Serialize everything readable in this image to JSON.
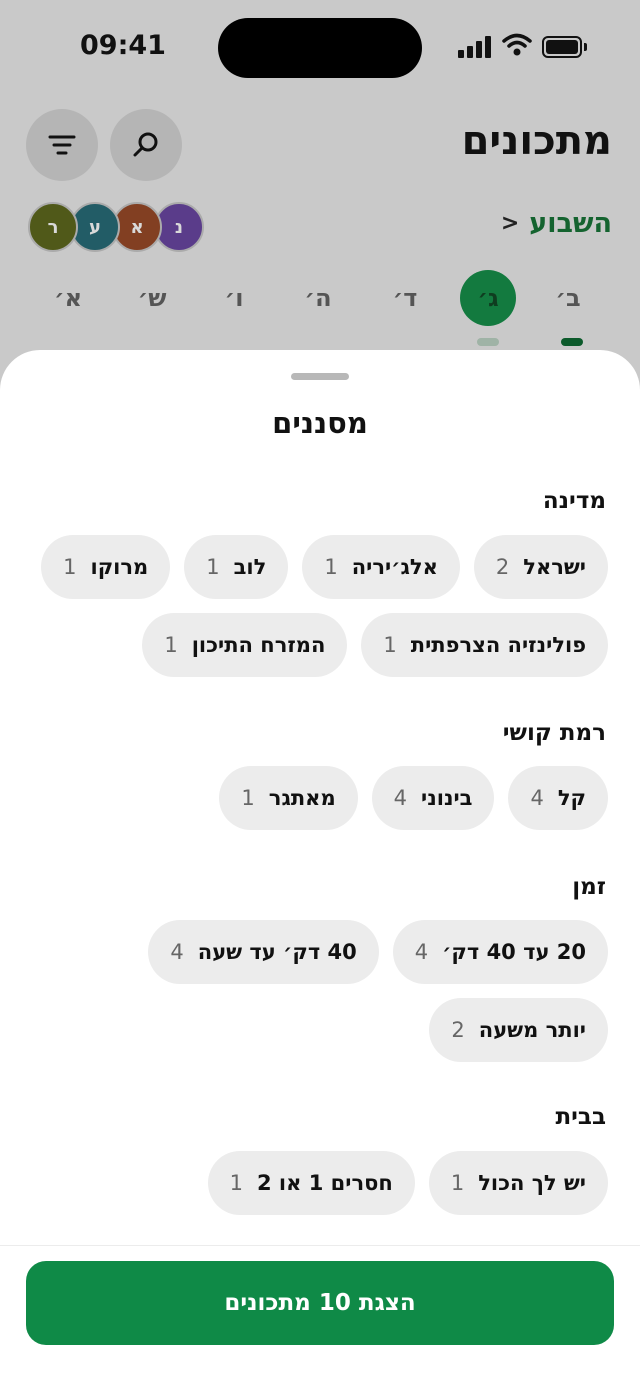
{
  "status_bar": {
    "time": "09:41"
  },
  "header": {
    "title": "מתכונים",
    "week_label": "השבוע",
    "avatars": [
      {
        "letter": "נ",
        "color": "#6d44b0"
      },
      {
        "letter": "א",
        "color": "#a4481f"
      },
      {
        "letter": "ע",
        "color": "#1e6f7c"
      },
      {
        "letter": "ר",
        "color": "#5e6a12"
      }
    ],
    "days": [
      {
        "label": "ב׳",
        "selected": false
      },
      {
        "label": "ג׳",
        "selected": true
      },
      {
        "label": "ד׳",
        "selected": false
      },
      {
        "label": "ה׳",
        "selected": false
      },
      {
        "label": "ו׳",
        "selected": false
      },
      {
        "label": "ש׳",
        "selected": false
      },
      {
        "label": "א׳",
        "selected": false
      }
    ],
    "icons": {
      "filter": "filter-icon",
      "search": "search-icon"
    }
  },
  "filters": {
    "title": "מסננים",
    "sections": [
      {
        "title": "מדינה",
        "rows": [
          [
            {
              "label": "ישראל",
              "count": "2"
            },
            {
              "label": "אלג׳יריה",
              "count": "1"
            },
            {
              "label": "לוב",
              "count": "1"
            },
            {
              "label": "מרוקו",
              "count": "1"
            }
          ],
          [
            {
              "label": "פולינזיה הצרפתית",
              "count": "1"
            },
            {
              "label": "המזרח התיכון",
              "count": "1"
            }
          ]
        ]
      },
      {
        "title": "רמת קושי",
        "rows": [
          [
            {
              "label": "קל",
              "count": "4"
            },
            {
              "label": "בינוני",
              "count": "4"
            },
            {
              "label": "מאתגר",
              "count": "1"
            }
          ]
        ]
      },
      {
        "title": "זמן",
        "rows": [
          [
            {
              "label": "20 עד 40 דק׳",
              "count": "4"
            },
            {
              "label": "40 דק׳ עד שעה",
              "count": "4"
            }
          ],
          [
            {
              "label": "יותר משעה",
              "count": "2"
            }
          ]
        ]
      },
      {
        "title": "בבית",
        "rows": [
          [
            {
              "label": "יש לך הכול",
              "count": "1"
            },
            {
              "label": "חסרים 1 או 2",
              "count": "1"
            }
          ]
        ]
      }
    ],
    "cta_label": "הצגת 10 מתכונים"
  }
}
